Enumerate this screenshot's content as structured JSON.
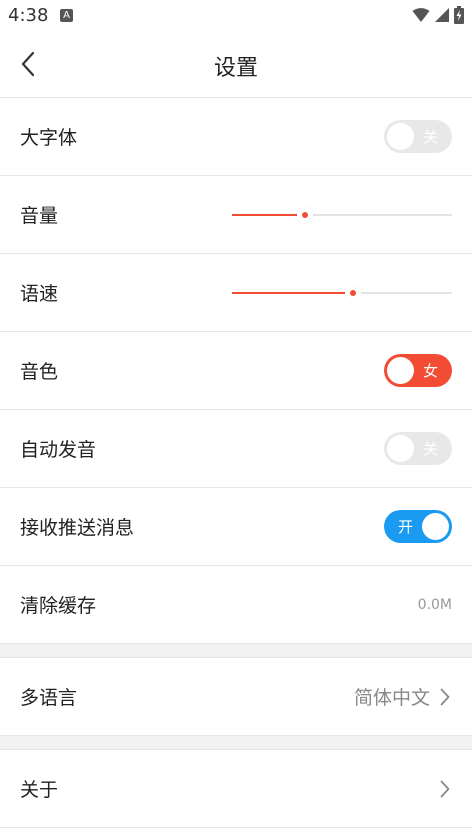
{
  "status_bar": {
    "time": "4:38",
    "a_badge": "A",
    "icons": [
      "wifi-icon",
      "signal-icon",
      "battery-icon"
    ]
  },
  "header": {
    "title": "设置",
    "back_icon": "chevron-left-icon"
  },
  "settings": {
    "large_font": {
      "label": "大字体",
      "toggle_text": "关",
      "state": "off"
    },
    "volume": {
      "label": "音量",
      "level": 0.33
    },
    "speech_rate": {
      "label": "语速",
      "level": 0.55
    },
    "voice": {
      "label": "音色",
      "toggle_text": "女",
      "state": "on"
    },
    "auto_pronounce": {
      "label": "自动发音",
      "toggle_text": "关",
      "state": "off"
    },
    "push": {
      "label": "接收推送消息",
      "toggle_text": "开",
      "state": "on"
    },
    "clear_cache": {
      "label": "清除缓存",
      "value": "0.0M"
    },
    "language": {
      "label": "多语言",
      "value": "简体中文"
    },
    "about": {
      "label": "关于"
    }
  },
  "colors": {
    "accent_red": "#f24d34",
    "accent_blue": "#1a9af0",
    "toggle_off": "#e8e8e8"
  }
}
